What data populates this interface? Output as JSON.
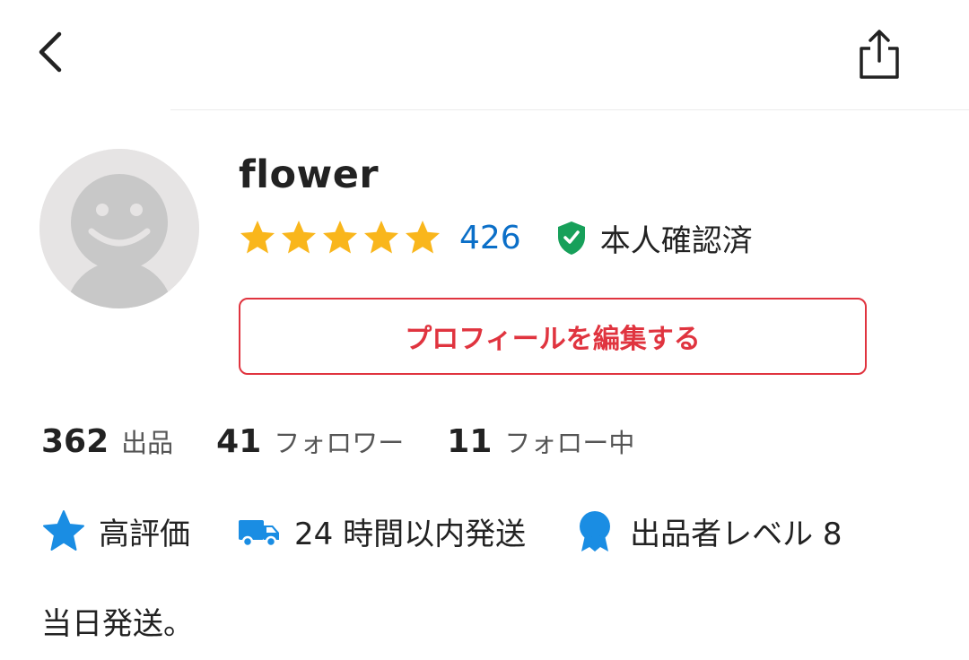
{
  "header": {
    "back_icon": "chevron-left-icon",
    "share_icon": "share-icon"
  },
  "profile": {
    "avatar_icon": "default-avatar-icon",
    "username": "flower",
    "rating": 5,
    "rating_max": 5,
    "rating_count": "426",
    "verified_icon": "shield-check-icon",
    "verified_label": "本人確認済",
    "edit_button_label": "プロフィールを編集する"
  },
  "stats": [
    {
      "value": "362",
      "label": "出品"
    },
    {
      "value": "41",
      "label": "フォロワー"
    },
    {
      "value": "11",
      "label": "フォロー中"
    }
  ],
  "badges": [
    {
      "icon": "star-icon",
      "label": "高評価"
    },
    {
      "icon": "truck-icon",
      "label": "24 時間以内発送"
    },
    {
      "icon": "medal-icon",
      "label": "出品者レベル 8"
    }
  ],
  "bio": "当日発送。",
  "colors": {
    "star": "#f9b61c",
    "link_blue": "#0b6fc8",
    "badge_blue": "#1a8de3",
    "verified_green": "#17a05a",
    "accent_red": "#e0343f"
  }
}
